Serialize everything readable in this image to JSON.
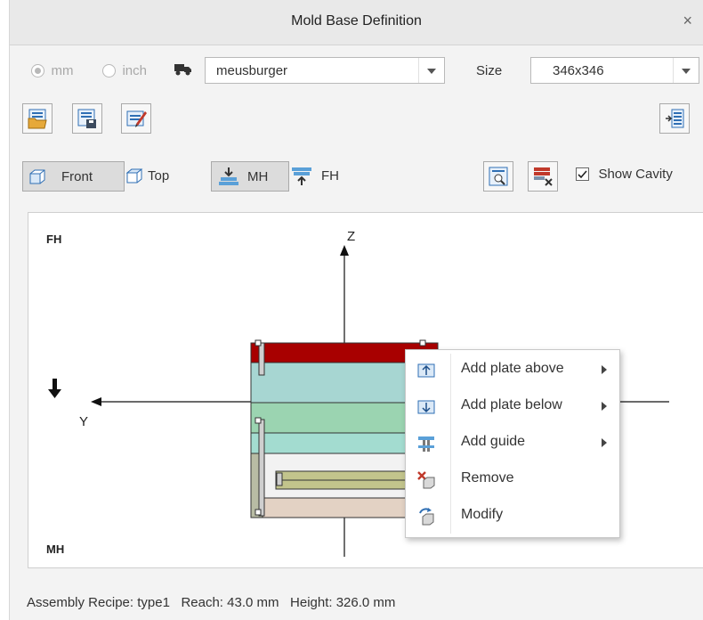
{
  "window": {
    "title": "Mold Base Definition",
    "close_symbol": "×"
  },
  "units": {
    "mm": "mm",
    "inch": "inch"
  },
  "supplier": {
    "value": "meusburger"
  },
  "size": {
    "label": "Size",
    "value": "346x346"
  },
  "view": {
    "front": "Front",
    "top": "Top",
    "mh": "MH",
    "fh": "FH"
  },
  "show_cavity": {
    "label": "Show Cavity",
    "checked": true
  },
  "canvas": {
    "fh": "FH",
    "mh": "MH",
    "z": "Z",
    "y": "Y"
  },
  "context_menu": {
    "items": [
      {
        "label": "Add plate above",
        "icon": "add-plate-above-icon",
        "submenu": true
      },
      {
        "label": "Add plate below",
        "icon": "add-plate-below-icon",
        "submenu": true
      },
      {
        "label": "Add guide",
        "icon": "add-guide-icon",
        "submenu": true
      },
      {
        "label": "Remove",
        "icon": "remove-icon",
        "submenu": false
      },
      {
        "label": "Modify",
        "icon": "modify-icon",
        "submenu": false
      }
    ]
  },
  "status": {
    "recipe_label": "Assembly Recipe:",
    "recipe": "type1",
    "reach_label": "Reach:",
    "reach": "43.0 mm",
    "height_label": "Height:",
    "height": "326.0 mm"
  },
  "colors": {
    "clamp_plate": "#a80000",
    "cavity_plate": "#a7d6d2",
    "core_plate": "#9bd4b1",
    "support_plate": "#a3dcd0",
    "ejector_plate": "#c2c48c",
    "bottom_plate": "#e3d2c4"
  }
}
